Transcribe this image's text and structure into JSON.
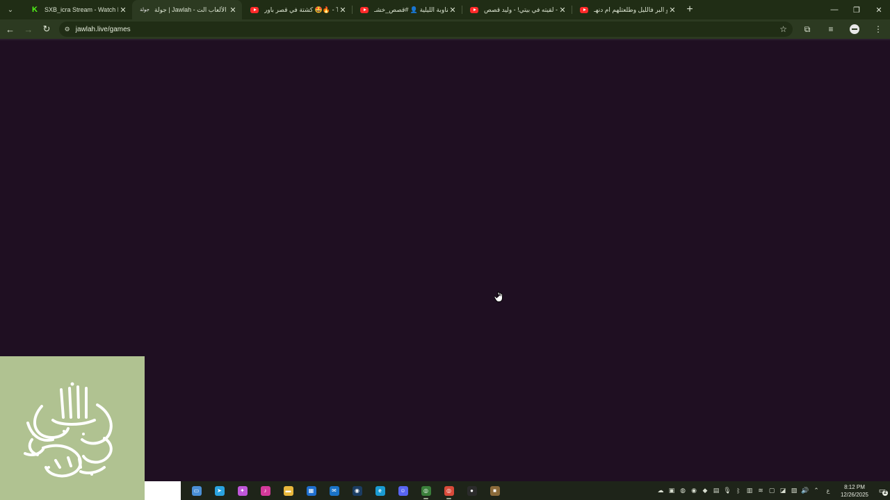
{
  "browser": {
    "tabs": [
      {
        "title": "SXB_icra Stream - Watch Live on",
        "favicon": "kick-icon",
        "active": false
      },
      {
        "title": "جولة | Jawlah - منصة الألعاب الت",
        "favicon": "jawlah-icon",
        "active": true
      },
      {
        "title": "كشتة في قصر باور 🤩🔥 - Tube",
        "favicon": "youtube-icon",
        "active": false
      },
      {
        "title": "المناوبة الليلية 👤 #قصص_خشـ...",
        "favicon": "youtube-icon",
        "active": false
      },
      {
        "title": "لقيته في بيتي! - وليد قصص - be",
        "favicon": "youtube-icon",
        "active": false
      },
      {
        "title": "راحو البر فالليل وطلعتلهم ام دنهـ",
        "favicon": "youtube-icon",
        "active": false
      }
    ],
    "url": "jawlah.live/games",
    "favicon_text": "جولة"
  },
  "taskbar": {
    "apps": [
      {
        "name": "file-explorer-folder",
        "color": "#4a8fd6",
        "glyph": "▭"
      },
      {
        "name": "telegram",
        "color": "#2aa3e0",
        "glyph": "➤"
      },
      {
        "name": "copilot",
        "color": "#c057d9",
        "glyph": "✦"
      },
      {
        "name": "music-app",
        "color": "#d43a9b",
        "glyph": "♪"
      },
      {
        "name": "folder",
        "color": "#e8b73c",
        "glyph": "▬"
      },
      {
        "name": "microsoft-store",
        "color": "#1f6fcf",
        "glyph": "▦"
      },
      {
        "name": "outlook",
        "color": "#1a73c8",
        "glyph": "✉"
      },
      {
        "name": "steam",
        "color": "#1b3d63",
        "glyph": "◉"
      },
      {
        "name": "edge",
        "color": "#1a9bd2",
        "glyph": "e"
      },
      {
        "name": "discord",
        "color": "#5865f2",
        "glyph": "☺"
      },
      {
        "name": "chrome-profile",
        "color": "#3a7f3a",
        "glyph": "◎"
      },
      {
        "name": "chrome",
        "color": "#d94a3a",
        "glyph": "◎"
      },
      {
        "name": "app-dark",
        "color": "#2b2b2b",
        "glyph": "●"
      },
      {
        "name": "minecraft",
        "color": "#8a6a3a",
        "glyph": "■"
      }
    ],
    "lang": "ع",
    "time": "8:12 PM",
    "date": "12/26/2025",
    "notification_count": "2"
  }
}
